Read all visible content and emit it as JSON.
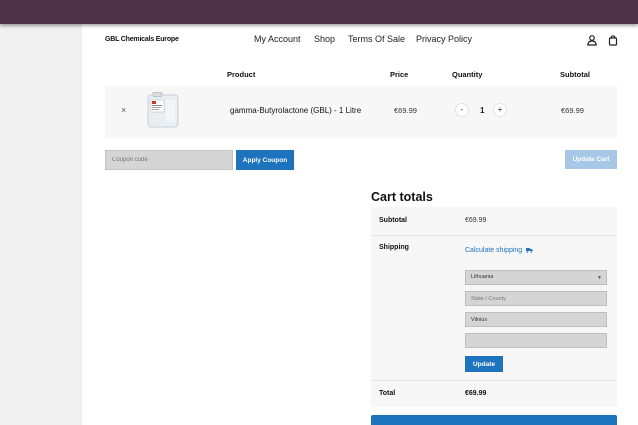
{
  "header": {
    "logo": "GBL Chemicals Europe",
    "nav": [
      "My Account",
      "Shop",
      "Terms Of Sale",
      "Privacy Policy"
    ],
    "icons": [
      "account-icon",
      "bag-icon"
    ]
  },
  "table": {
    "headers": {
      "product": "Product",
      "price": "Price",
      "quantity": "Quantity",
      "subtotal": "Subtotal"
    },
    "rows": [
      {
        "remove": "×",
        "name": "gamma-Butyrolactone (GBL) - 1 Litre",
        "price": "€69.99",
        "qty_minus": "-",
        "quantity": "1",
        "qty_plus": "+",
        "subtotal": "€69.99"
      }
    ]
  },
  "coupon": {
    "placeholder": "Coupon code",
    "apply_label": "Apply Coupon",
    "update_label": "Update Cart"
  },
  "totals": {
    "title": "Cart totals",
    "subtotal_label": "Subtotal",
    "subtotal_value": "€69.99",
    "shipping_label": "Shipping",
    "calculate_shipping": "Calculate shipping",
    "country": "Lithuania",
    "state_placeholder": "State / County",
    "city": "Vilnius",
    "postcode": "",
    "update_label": "Update",
    "total_label": "Total",
    "total_value": "€69.99"
  },
  "colors": {
    "topbar": "#4e3347",
    "accent": "#1e73be",
    "accent_disabled": "#a7c7e7"
  }
}
